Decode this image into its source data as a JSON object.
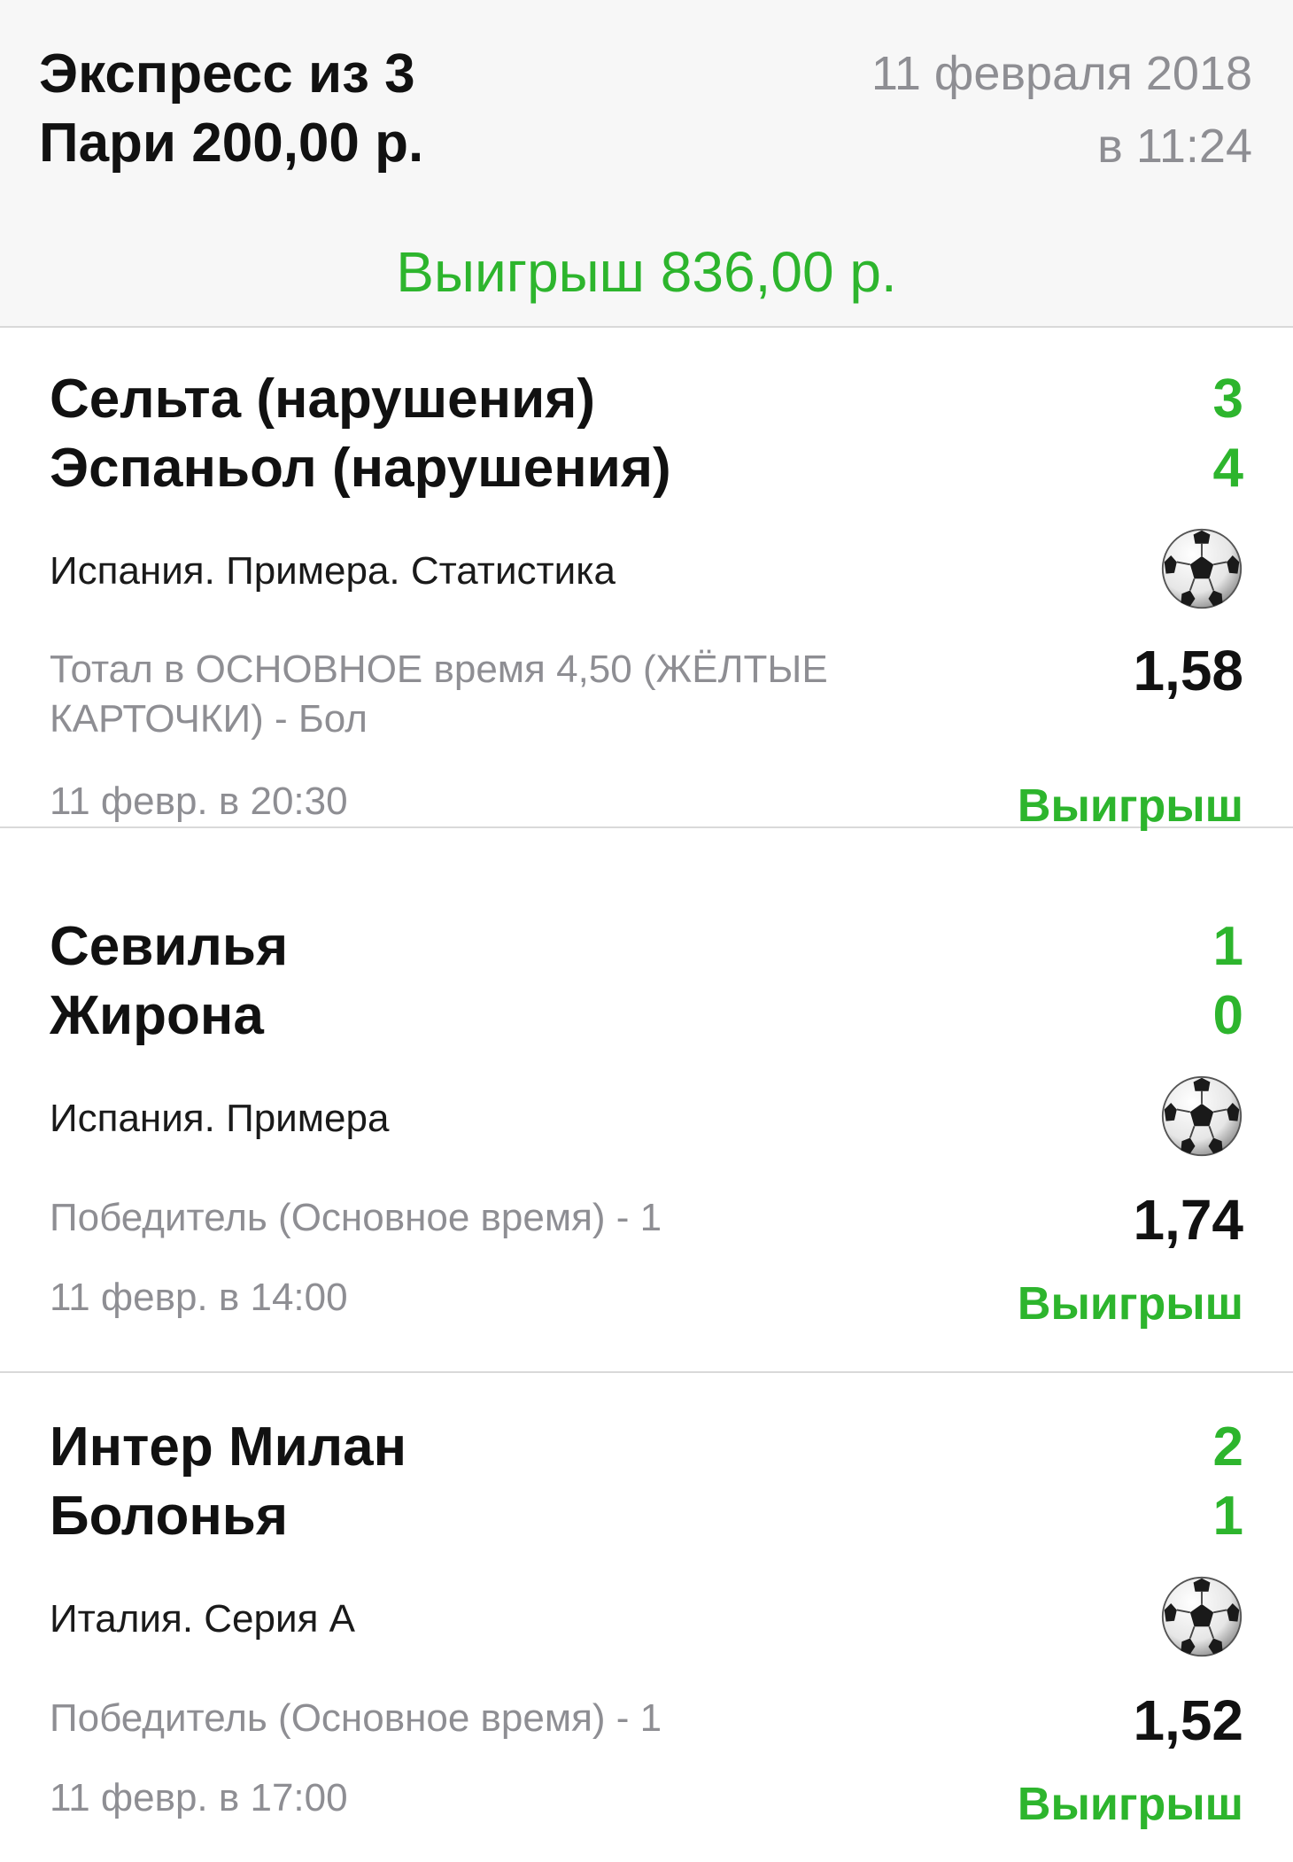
{
  "header": {
    "title_line1": "Экспресс из 3",
    "title_line2": "Пари 200,00 р.",
    "date_line1": "11 февраля 2018",
    "date_line2": "в 11:24",
    "winnings": "Выигрыш 836,00 р."
  },
  "colors": {
    "accent_green": "#2db52d",
    "secondary_gray": "#8e8e93"
  },
  "bets": [
    {
      "team1": "Сельта (нарушения)",
      "score1": "3",
      "team2": "Эспаньол (нарушения)",
      "score2": "4",
      "league": "Испания. Примера. Статистика",
      "sport_icon": "soccer-ball-icon",
      "market": "Тотал в ОСНОВНОЕ время 4,50 (ЖЁЛТЫЕ КАРТОЧКИ) - Бол",
      "odds": "1,58",
      "time": "11 февр. в 20:30",
      "status": "Выигрыш"
    },
    {
      "team1": "Севилья",
      "score1": "1",
      "team2": "Жирона",
      "score2": "0",
      "league": "Испания. Примера",
      "sport_icon": "soccer-ball-icon",
      "market": "Победитель (Основное время) - 1",
      "odds": "1,74",
      "time": "11 февр. в 14:00",
      "status": "Выигрыш"
    },
    {
      "team1": "Интер Милан",
      "score1": "2",
      "team2": "Болонья",
      "score2": "1",
      "league": "Италия. Серия А",
      "sport_icon": "soccer-ball-icon",
      "market": "Победитель (Основное время) - 1",
      "odds": "1,52",
      "time": "11 февр. в 17:00",
      "status": "Выигрыш"
    }
  ]
}
